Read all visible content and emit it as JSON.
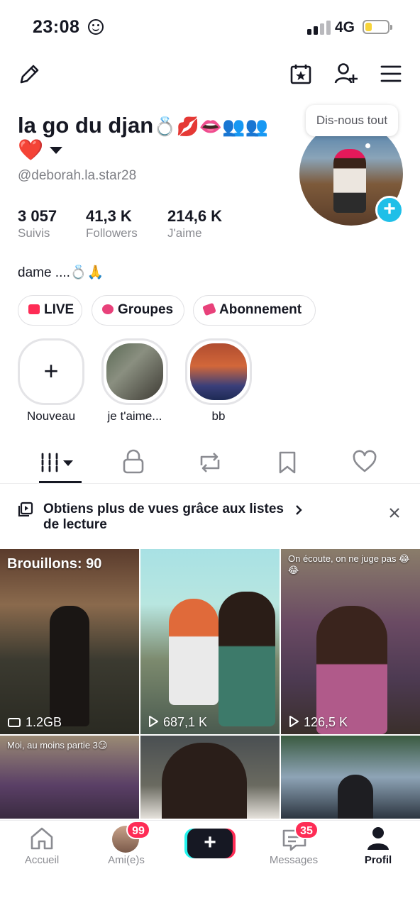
{
  "status_bar": {
    "time": "23:08",
    "network": "4G",
    "battery_percent": 20
  },
  "profile": {
    "display_name": "la go du djan",
    "display_name_emojis": "💍💋👄👥👥",
    "display_name_line2": "❤️",
    "username": "@deborah.la.star28",
    "avatar_tooltip": "Dis-nous tout",
    "bio": "dame ....💍🙏"
  },
  "stats": [
    {
      "value": "3 057",
      "label": "Suivis"
    },
    {
      "value": "41,3 K",
      "label": "Followers"
    },
    {
      "value": "214,6 K",
      "label": "J'aime"
    }
  ],
  "pills": [
    {
      "label": "LIVE",
      "icon": "live-icon",
      "color": "#fe2c55"
    },
    {
      "label": "Groupes",
      "icon": "groups-icon",
      "color": "#e8417a"
    },
    {
      "label": "Abonnement",
      "icon": "subscription-icon",
      "color": "#e8417a"
    }
  ],
  "stories": [
    {
      "label": "Nouveau",
      "icon": "plus-icon"
    },
    {
      "label": "je t'aime..."
    },
    {
      "label": "bb"
    }
  ],
  "tabs": [
    {
      "icon": "videos-grid-icon",
      "active": true
    },
    {
      "icon": "lock-icon"
    },
    {
      "icon": "repost-icon"
    },
    {
      "icon": "bookmark-icon"
    },
    {
      "icon": "heart-icon"
    }
  ],
  "banner": {
    "text": "Obtiens plus de vues grâce aux listes",
    "text_line2": "de lecture",
    "icon": "playlist-icon"
  },
  "videos": [
    {
      "overlay": "Brouillons: 90",
      "stat": "1.2GB",
      "stat_icon": "drafts-icon"
    },
    {
      "stat": "687,1 K",
      "stat_icon": "play-icon"
    },
    {
      "caption": "On écoute, on ne juge pas 😂😂",
      "stat": "126,5 K",
      "stat_icon": "play-icon"
    },
    {
      "caption": "Moi, au moins partie 3😏"
    },
    {},
    {}
  ],
  "nav": [
    {
      "label": "Accueil",
      "icon": "home-icon"
    },
    {
      "label": "Ami(e)s",
      "badge": "99"
    },
    {
      "label": "",
      "icon": "create-icon"
    },
    {
      "label": "Messages",
      "badge": "35",
      "icon": "inbox-icon"
    },
    {
      "label": "Profil",
      "icon": "profile-icon",
      "active": true
    }
  ]
}
